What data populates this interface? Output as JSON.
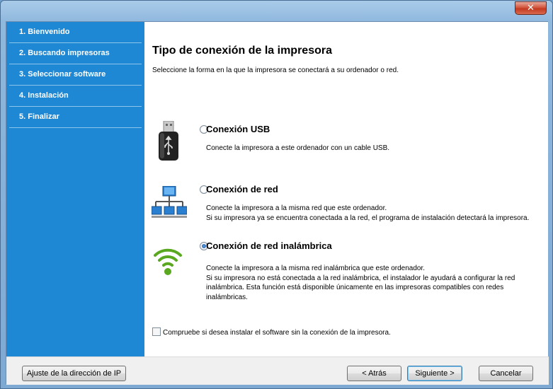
{
  "window": {
    "close_glyph": "✕"
  },
  "sidebar": {
    "items": [
      {
        "label": "1. Bienvenido"
      },
      {
        "label": "2. Buscando impresoras"
      },
      {
        "label": "3. Seleccionar software"
      },
      {
        "label": "4. Instalación"
      },
      {
        "label": "5. Finalizar"
      }
    ]
  },
  "main": {
    "title": "Tipo de conexión de la impresora",
    "subtitle": "Seleccione la forma en la que la impresora se conectará a su ordenador o red.",
    "options": [
      {
        "icon": "usb-icon",
        "title": "Conexión USB",
        "description": "Conecte la impresora a este ordenador con un cable USB.",
        "selected": false
      },
      {
        "icon": "network-icon",
        "title": "Conexión de red",
        "description_lines": [
          "Conecte la impresora a la misma red que este ordenador.",
          "Si su impresora ya se encuentra conectada a la red, el programa de instalación detectará la impresora."
        ],
        "selected": false
      },
      {
        "icon": "wifi-icon",
        "title": "Conexión de red inalámbrica",
        "description_lines": [
          "Conecte la impresora a la misma red inalámbrica que este ordenador.",
          "Si su impresora no está conectada a la red inalámbrica, el instalador le ayudará a configurar la red inalámbrica. Esta función está disponible únicamente en las impresoras compatibles con redes inalámbricas."
        ],
        "selected": true
      }
    ],
    "checkbox_label": "Compruebe si desea instalar el software sin la conexión de la impresora.",
    "checkbox_checked": false
  },
  "footer": {
    "ip_button": "Ajuste de la dirección de IP",
    "back_button": "< Atrás",
    "next_button": "Siguiente >",
    "cancel_button": "Cancelar"
  },
  "colors": {
    "sidebar": "#1f88d4",
    "wifi_green": "#5aa820",
    "network_blue": "#2a7fd0"
  }
}
